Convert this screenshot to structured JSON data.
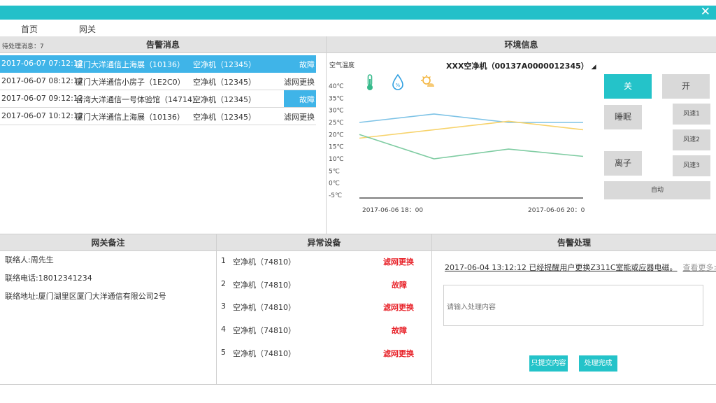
{
  "window": {
    "close_symbol": "✕"
  },
  "nav": {
    "items": [
      "首页",
      "网关"
    ]
  },
  "alarm_panel": {
    "title": "告警消息",
    "pending_label": "待处理消息：7",
    "rows": [
      {
        "time": "2017-06-07  07:12:12",
        "location": "厦门大洋通信上海展（10136）",
        "device": "空净机（12345）",
        "status": "故障",
        "selected": true
      },
      {
        "time": "2017-06-07  08:12:12",
        "location": "厦门大洋通信小房子（1E2C0）",
        "device": "空净机（12345）",
        "status": "滤网更换",
        "selected": false
      },
      {
        "time": "2017-06-07  09:12:12",
        "location": "台湾大洋通信一号体验馆（14714）",
        "device": "空净机（12345）",
        "status": "故障",
        "selected": false,
        "status_badge": true
      },
      {
        "time": "2017-06-07  10:12:12",
        "location": "厦门大洋通信上海展（10136）",
        "device": "空净机（12345）",
        "status": "滤网更换",
        "selected": false
      }
    ]
  },
  "env_panel": {
    "title": "环境信息",
    "sensor_label": "空气温度",
    "device_title": "XXX空净机（00137A0000012345）",
    "icons": [
      "thermometer-icon",
      "water-drop-icon",
      "sun-cloud-icon"
    ],
    "colors": {
      "blue": "#7ec3e6",
      "yellow": "#f7d36c",
      "green": "#7fcca2",
      "accent": "#24c3c9"
    }
  },
  "chart_data": {
    "type": "line",
    "x": [
      "2017-06-06  18：00",
      "2017-06-06  20：00"
    ],
    "x_ticks": [
      "2017-06-06  18：00",
      "2017-06-06  20：00"
    ],
    "y_ticks": [
      "40℃",
      "35℃",
      "30℃",
      "25℃",
      "20℃",
      "15℃",
      "10℃",
      "5℃",
      "0℃",
      "-5℃"
    ],
    "ylim": [
      -5,
      40
    ],
    "series": [
      {
        "color": "#7ec3e6",
        "values": [
          25,
          28.5,
          25,
          25
        ]
      },
      {
        "color": "#f7d36c",
        "values": [
          18.5,
          22,
          25.5,
          22
        ]
      },
      {
        "color": "#7fcca2",
        "values": [
          20,
          10,
          14,
          11
        ]
      }
    ]
  },
  "controls": {
    "off": "关",
    "on": "开",
    "sleep": "睡眠",
    "ion": "离子",
    "speed1": "风速1",
    "speed2": "风速2",
    "speed3": "风速3",
    "auto": "自动"
  },
  "gateway_panel": {
    "title": "网关备注",
    "contact": "联络人:周先生",
    "phone": "联络电话:18012341234",
    "address": "联络地址:厦门湖里区厦门大洋通信有限公司2号"
  },
  "abnormal_panel": {
    "title": "异常设备",
    "items": [
      {
        "num": "1",
        "name": "空净机（74810）",
        "status": "滤网更换"
      },
      {
        "num": "2",
        "name": "空净机（74810）",
        "status": "故障"
      },
      {
        "num": "3",
        "name": "空净机（74810）",
        "status": "滤网更换"
      },
      {
        "num": "4",
        "name": "空净机（74810）",
        "status": "故障"
      },
      {
        "num": "5",
        "name": "空净机（74810）",
        "status": "滤网更换"
      }
    ]
  },
  "handle_panel": {
    "title": "告警处理",
    "last_record": "2017-06-04  13:12:12    已经提醒用户更换Z311C室能或应器电磁。",
    "more": "查看更多>>",
    "placeholder": "请输入处理内容",
    "submit_only": "只提交内容",
    "done": "处理完成"
  }
}
